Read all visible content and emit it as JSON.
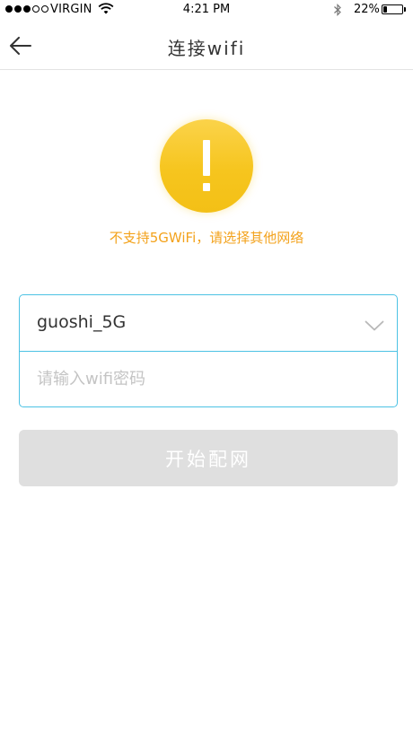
{
  "status_bar": {
    "carrier": "VIRGIN",
    "time": "4:21 PM",
    "battery": "22%",
    "battery_level": 0.22,
    "icons": [
      "signal-dots",
      "wifi-icon",
      "bluetooth-icon",
      "battery-icon"
    ]
  },
  "nav": {
    "title": "连接wifi",
    "back_icon": "arrow-left-icon"
  },
  "warning": {
    "icon": "exclamation-icon",
    "message": "不支持5GWiFi，请选择其他网络",
    "colors": {
      "circle": "#f6c51e",
      "text": "#f3a21b"
    }
  },
  "form": {
    "ssid": "guoshi_5G",
    "dropdown_icon": "chevron-down-icon",
    "password_placeholder": "请输入wifi密码",
    "border_color": "#4cc2e4"
  },
  "actions": {
    "start_label": "开始配网",
    "button_color": "#dfdfdf"
  }
}
